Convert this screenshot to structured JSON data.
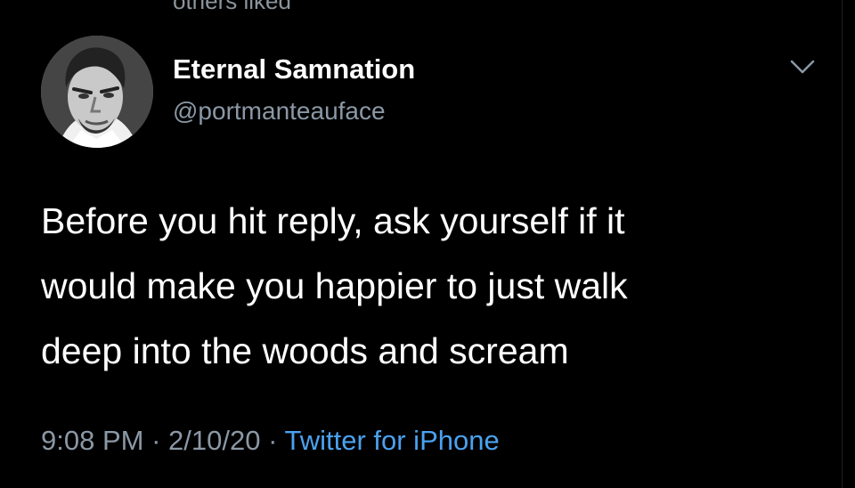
{
  "tweet": {
    "context_text": "others liked",
    "author": {
      "display_name": "Eternal Samnation",
      "handle": "@portmanteauface"
    },
    "text": "Before you hit reply, ask yourself if it\nwould make you happier to just walk\ndeep into the woods and scream",
    "time": "9:08 PM",
    "separator": "·",
    "date": "2/10/20",
    "source": "Twitter for iPhone"
  },
  "icons": {
    "menu": "chevron-down-icon",
    "avatar": "avatar"
  },
  "colors": {
    "background": "#000000",
    "primary_text": "#ffffff",
    "secondary_text": "#8b98a5",
    "link": "#4aa2ef"
  }
}
